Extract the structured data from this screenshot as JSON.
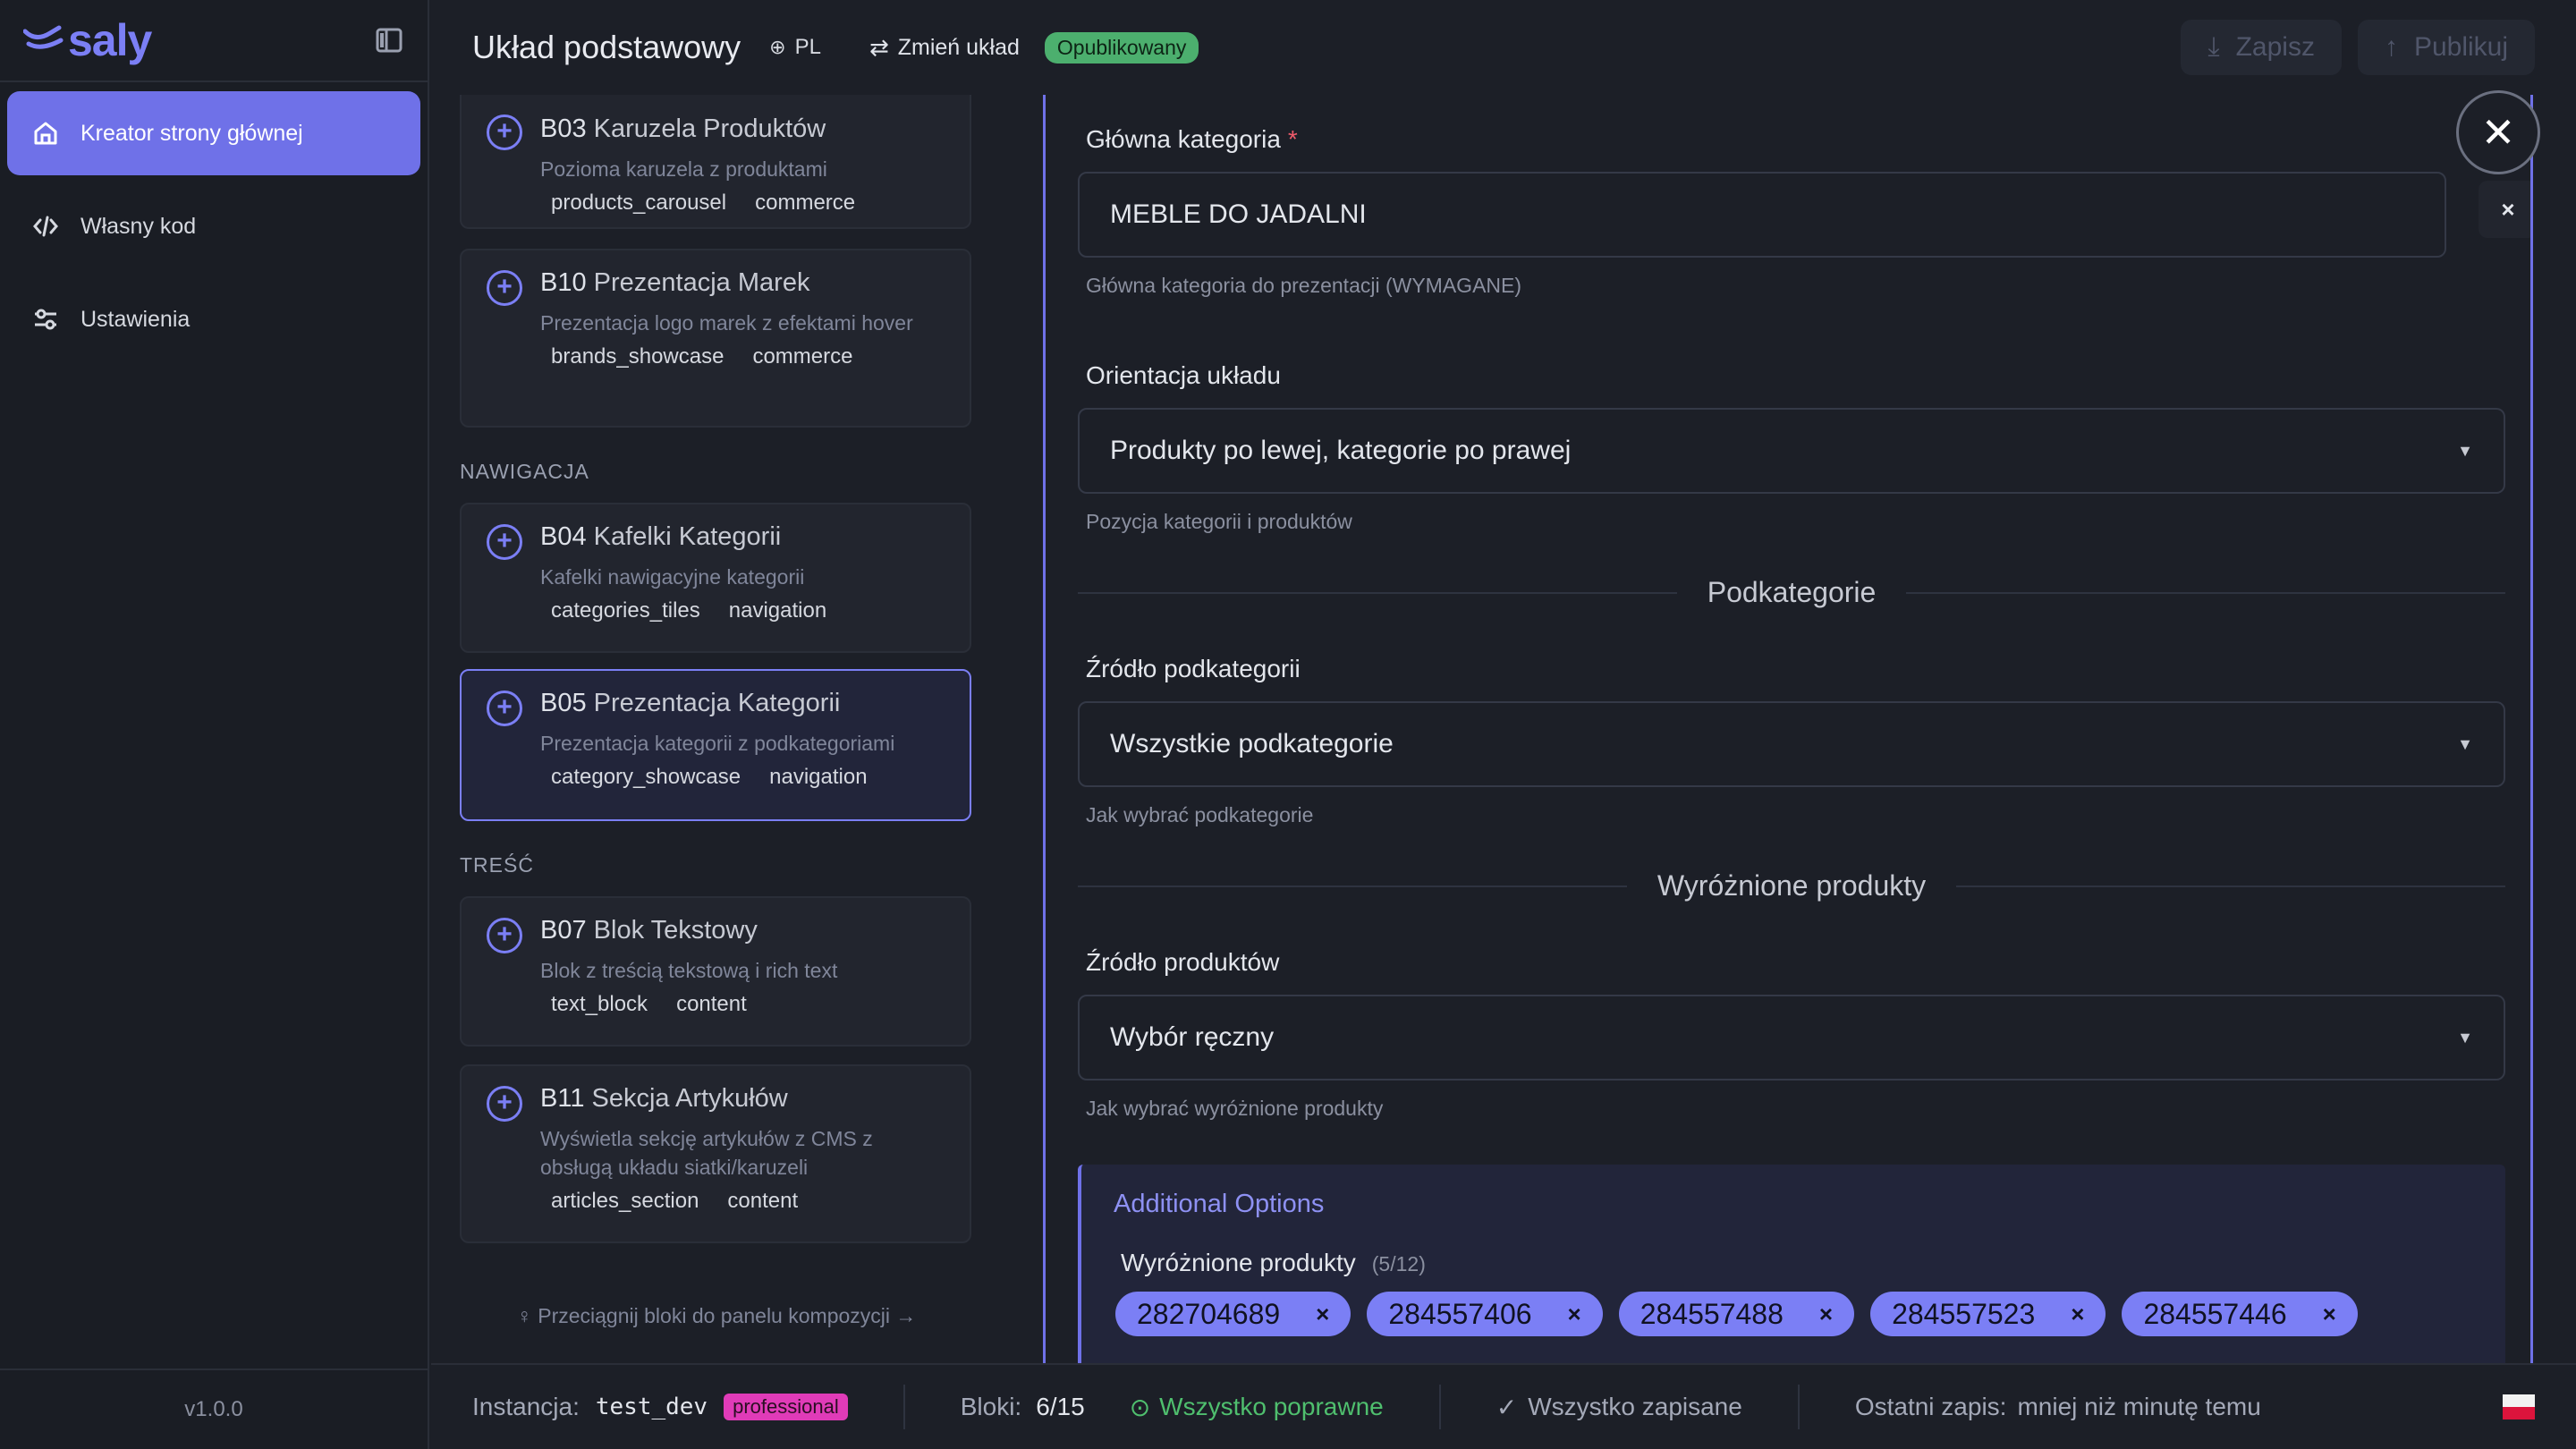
{
  "app": {
    "name": "saly",
    "version": "v1.0.0"
  },
  "sidebar": {
    "items": [
      {
        "label": "Kreator strony głównej",
        "icon": "home-icon",
        "active": true
      },
      {
        "label": "Własny kod",
        "icon": "code-icon",
        "active": false
      },
      {
        "label": "Ustawienia",
        "icon": "settings-sliders-icon",
        "active": false
      }
    ]
  },
  "topbar": {
    "layout_title": "Układ podstawowy",
    "language": "PL",
    "change_layout": "Zmień układ",
    "status_badge": "Opublikowany",
    "save_label": "Zapisz",
    "publish_label": "Publikuj"
  },
  "library": {
    "cards": [
      {
        "code": "B03",
        "name": "Karuzela Produktów",
        "desc": "Pozioma karuzela z produktami",
        "tags": [
          "products_carousel",
          "commerce"
        ]
      },
      {
        "code": "B10",
        "name": "Prezentacja Marek",
        "desc": "Prezentacja logo marek z efektami hover",
        "tags": [
          "brands_showcase",
          "commerce"
        ]
      },
      {
        "code": "B04",
        "name": "Kafelki Kategorii",
        "desc": "Kafelki nawigacyjne kategorii",
        "tags": [
          "categories_tiles",
          "navigation"
        ]
      },
      {
        "code": "B05",
        "name": "Prezentacja Kategorii",
        "desc": "Prezentacja kategorii z podkategoriami",
        "tags": [
          "category_showcase",
          "navigation"
        ]
      },
      {
        "code": "B07",
        "name": "Blok Tekstowy",
        "desc": "Blok z treścią tekstową i rich text",
        "tags": [
          "text_block",
          "content"
        ]
      },
      {
        "code": "B11",
        "name": "Sekcja Artykułów",
        "desc": "Wyświetla sekcję artykułów z CMS z obsługą układu siatki/karuzeli",
        "tags": [
          "articles_section",
          "content"
        ]
      }
    ],
    "section_navigation": "NAWIGACJA",
    "section_content": "TREŚĆ",
    "hint": "Przeciągnij bloki do panelu kompozycji →"
  },
  "editor": {
    "main_category": {
      "label": "Główna kategoria",
      "required_mark": "*",
      "value": "MEBLE DO JADALNI",
      "helper": "Główna kategoria do prezentacji (WYMAGANE)"
    },
    "orientation": {
      "label": "Orientacja układu",
      "value": "Produkty po lewej, kategorie po prawej",
      "helper": "Pozycja kategorii i produktów"
    },
    "subcategories_header": "Podkategorie",
    "subcat_source": {
      "label": "Źródło podkategorii",
      "value": "Wszystkie podkategorie",
      "helper": "Jak wybrać podkategorie"
    },
    "featured_header": "Wyróżnione produkty",
    "product_source": {
      "label": "Źródło produktów",
      "value": "Wybór ręczny",
      "helper": "Jak wybrać wyróżnione produkty"
    },
    "additional": {
      "title": "Additional Options",
      "featured_label": "Wyróżnione produkty",
      "featured_count": "(5/12)",
      "chips": [
        "282704689",
        "284557406",
        "284557488",
        "284557523",
        "284557446"
      ]
    }
  },
  "status": {
    "instance_label": "Instancja:",
    "instance": "test_dev",
    "plan": "professional",
    "blocks_label": "Bloki:",
    "blocks": "6/15",
    "valid": "Wszystko poprawne",
    "saved": "Wszystko zapisane",
    "last_save_label": "Ostatni zapis:",
    "last_save": "mniej niż minutę temu"
  },
  "colors": {
    "accent": "#6f71e8",
    "success": "#4caf6e",
    "plan": "#e03bb8"
  }
}
